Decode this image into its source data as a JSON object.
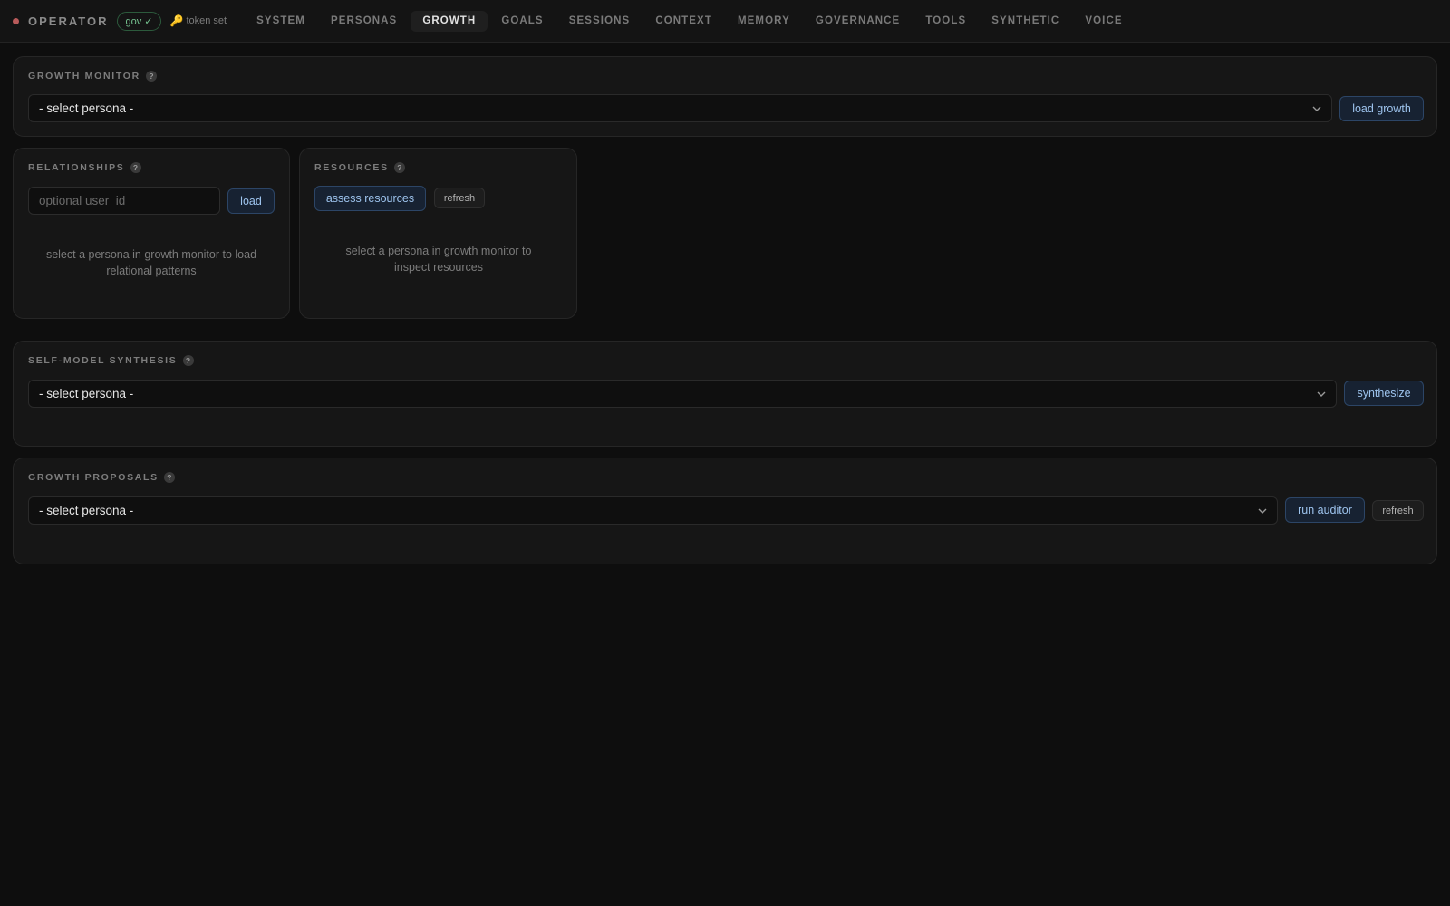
{
  "header": {
    "brand": "OPERATOR",
    "gov_badge": "gov ✓",
    "token_icon": "🔑",
    "token_label": "token set",
    "tabs": [
      {
        "label": "SYSTEM"
      },
      {
        "label": "PERSONAS"
      },
      {
        "label": "GROWTH"
      },
      {
        "label": "GOALS"
      },
      {
        "label": "SESSIONS"
      },
      {
        "label": "CONTEXT"
      },
      {
        "label": "MEMORY"
      },
      {
        "label": "GOVERNANCE"
      },
      {
        "label": "TOOLS"
      },
      {
        "label": "SYNTHETIC"
      },
      {
        "label": "VOICE"
      }
    ],
    "active_tab": "GROWTH"
  },
  "growth_monitor": {
    "title": "GROWTH MONITOR",
    "select_value": "- select persona -",
    "button": "load growth"
  },
  "relationships": {
    "title": "RELATIONSHIPS",
    "input_placeholder": "optional user_id",
    "button": "load",
    "empty_message": "select a persona in growth monitor to load relational patterns"
  },
  "resources": {
    "title": "RESOURCES",
    "button_primary": "assess resources",
    "button_secondary": "refresh",
    "empty_message": "select a persona in growth monitor to inspect resources"
  },
  "self_model": {
    "title": "SELF-MODEL SYNTHESIS",
    "select_value": "- select persona -",
    "button": "synthesize"
  },
  "growth_proposals": {
    "title": "GROWTH PROPOSALS",
    "select_value": "- select persona -",
    "button_primary": "run auditor",
    "button_secondary": "refresh"
  },
  "help_glyph": "?",
  "colors": {
    "background": "#0e0e0e",
    "panel": "#161616",
    "accent_button": "#172232",
    "accent_text": "#9ec4ee",
    "gov_badge": "#73c08e",
    "status_dot": "#b85a5a"
  }
}
